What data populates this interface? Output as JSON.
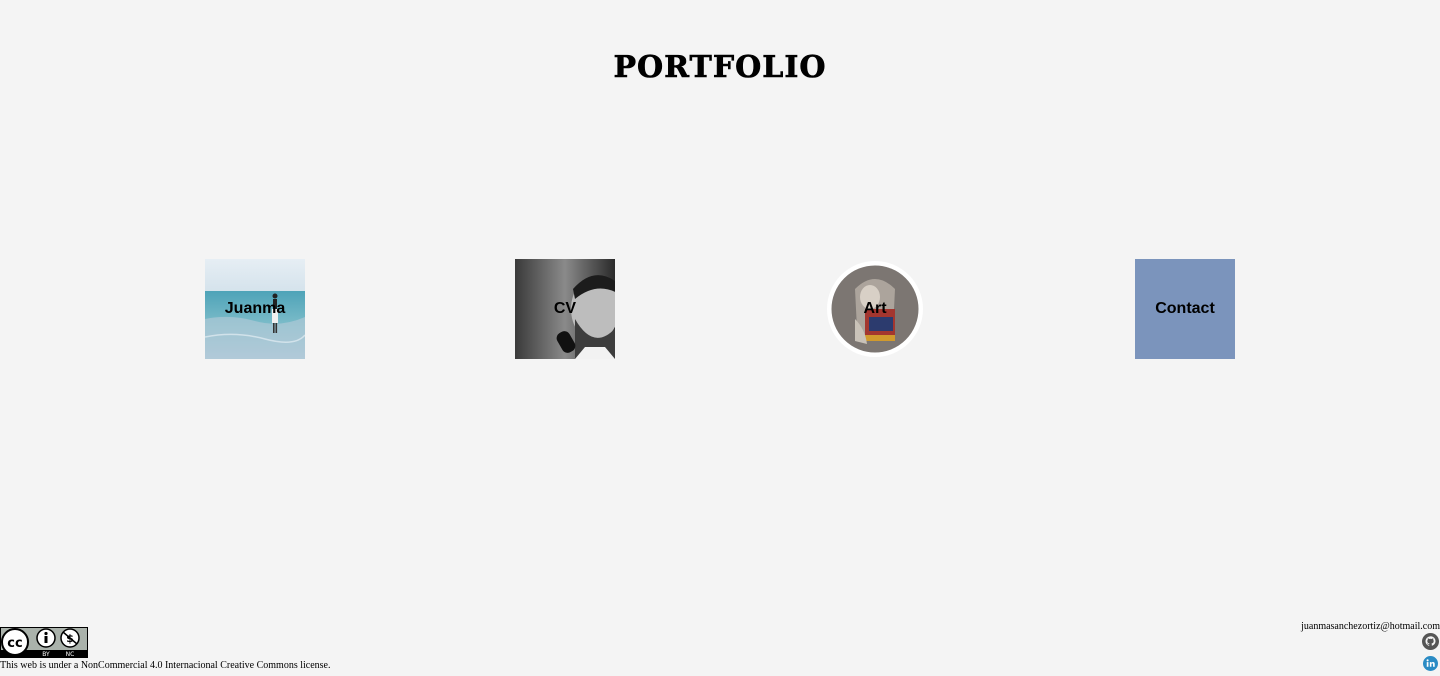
{
  "header": {
    "title": "PORTFOLIO"
  },
  "tiles": [
    {
      "label": "Juanma",
      "image": "beach-photo"
    },
    {
      "label": "CV",
      "image": "portrait-photo-bw"
    },
    {
      "label": "Art",
      "image": "painting-circle"
    },
    {
      "label": "Contact",
      "color": "#7b94bc"
    }
  ],
  "footer": {
    "license_badge": {
      "text_left": "BY",
      "text_right": "NC"
    },
    "license_text": "This web is under a NonCommercial 4.0 Internacional Creative Commons license.",
    "email": "juanmasanchezortiz@hotmail.com",
    "icons": [
      "github-icon",
      "linkedin-icon"
    ]
  }
}
